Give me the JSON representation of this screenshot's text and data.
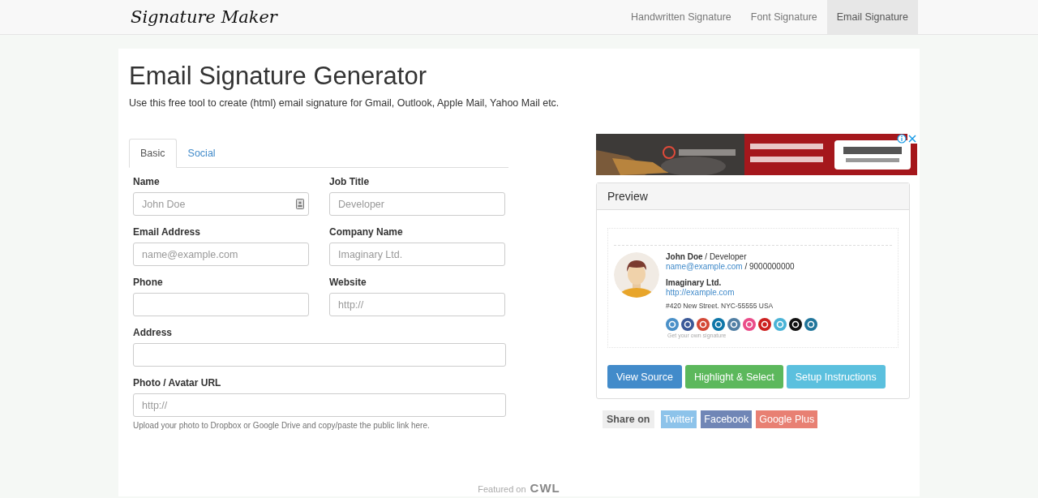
{
  "navbar": {
    "brand": "Signature Maker",
    "links": [
      {
        "label": "Handwritten Signature",
        "selected": false
      },
      {
        "label": "Font Signature",
        "selected": false
      },
      {
        "label": "Email Signature",
        "selected": true
      }
    ]
  },
  "page": {
    "title": "Email Signature Generator",
    "subtitle": "Use this free tool to create (html) email signature for Gmail, Outlook, Apple Mail, Yahoo Mail etc."
  },
  "tabs": [
    {
      "label": "Basic",
      "selected": true
    },
    {
      "label": "Social",
      "selected": false
    }
  ],
  "form_rows": [
    [
      {
        "label": "Name",
        "placeholder": "John Doe",
        "autofill_icon": true
      },
      {
        "label": "Job Title",
        "placeholder": "Developer"
      }
    ],
    [
      {
        "label": "Email Address",
        "placeholder": "name@example.com"
      },
      {
        "label": "Company Name",
        "placeholder": "Imaginary Ltd."
      }
    ],
    [
      {
        "label": "Phone"
      },
      {
        "label": "Website",
        "placeholder": "http://"
      }
    ],
    [
      {
        "label": "Address"
      }
    ],
    [
      {
        "label": "Photo / Avatar URL",
        "placeholder": "http://"
      }
    ]
  ],
  "form_help": "Upload your photo to Dropbox or Google Drive and copy/paste the public link here.",
  "preview": {
    "title": "Preview",
    "name": "John Doe",
    "job": " / Developer",
    "email": "name@example.com",
    "phone": " / 9000000000",
    "company": "Imaginary Ltd.",
    "website": "http://example.com",
    "address": "#420 New Street. NYC-55555 USA",
    "social_icons": [
      {
        "color": "#4a90c8"
      },
      {
        "color": "#3b5998"
      },
      {
        "color": "#d34836"
      },
      {
        "color": "#0e76a8"
      },
      {
        "color": "#517fa4"
      },
      {
        "color": "#ea4c89"
      },
      {
        "color": "#cd201f"
      },
      {
        "color": "#4ab3d6"
      },
      {
        "color": "#111111"
      },
      {
        "color": "#21759b"
      }
    ],
    "footer": "Get your own signature"
  },
  "actions": [
    {
      "label": "View Source",
      "kind": "primary"
    },
    {
      "label": "Highlight & Select",
      "kind": "success"
    },
    {
      "label": "Setup Instructions",
      "kind": "info"
    }
  ],
  "share": {
    "label": "Share on",
    "links": [
      {
        "label": "Twitter",
        "color": "#8dc3ea"
      },
      {
        "label": "Facebook",
        "color": "#7086b6"
      },
      {
        "label": "Google Plus",
        "color": "#e88073"
      }
    ]
  },
  "featured": {
    "text": "Featured on",
    "logo": "CWL"
  }
}
